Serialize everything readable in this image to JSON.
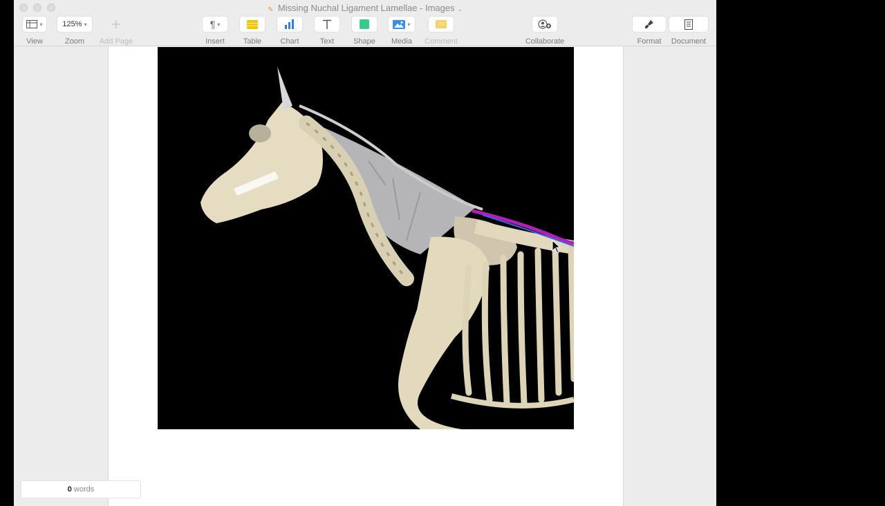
{
  "window": {
    "title": "Missing Nuchal Ligament Lamellae - Images"
  },
  "toolbar": {
    "view": {
      "label": "View",
      "icon": "sidebar-layout-icon"
    },
    "zoom": {
      "label": "Zoom",
      "value": "125%"
    },
    "add_page": {
      "label": "Add Page",
      "icon": "plus-icon"
    },
    "insert": {
      "label": "Insert",
      "icon": "paragraph-icon"
    },
    "table": {
      "label": "Table",
      "icon": "table-icon"
    },
    "chart": {
      "label": "Chart",
      "icon": "bar-chart-icon"
    },
    "text": {
      "label": "Text",
      "icon": "text-icon"
    },
    "shape": {
      "label": "Shape",
      "icon": "square-shape-icon"
    },
    "media": {
      "label": "Media",
      "icon": "image-icon"
    },
    "comment": {
      "label": "Comment",
      "icon": "comment-icon"
    },
    "collaborate": {
      "label": "Collaborate",
      "icon": "add-person-icon"
    },
    "format": {
      "label": "Format",
      "icon": "paintbrush-icon"
    },
    "document": {
      "label": "Document",
      "icon": "document-icon"
    }
  },
  "status": {
    "word_count": "0",
    "words_label": "words"
  },
  "colors": {
    "accent_ligament": "#b020b8",
    "table_icon": "#f5c400",
    "chart_icon": "#2a7fe0",
    "shape_icon": "#3cc98c",
    "media_icon": "#3a8ee6",
    "comment_icon": "#f2d36b"
  }
}
